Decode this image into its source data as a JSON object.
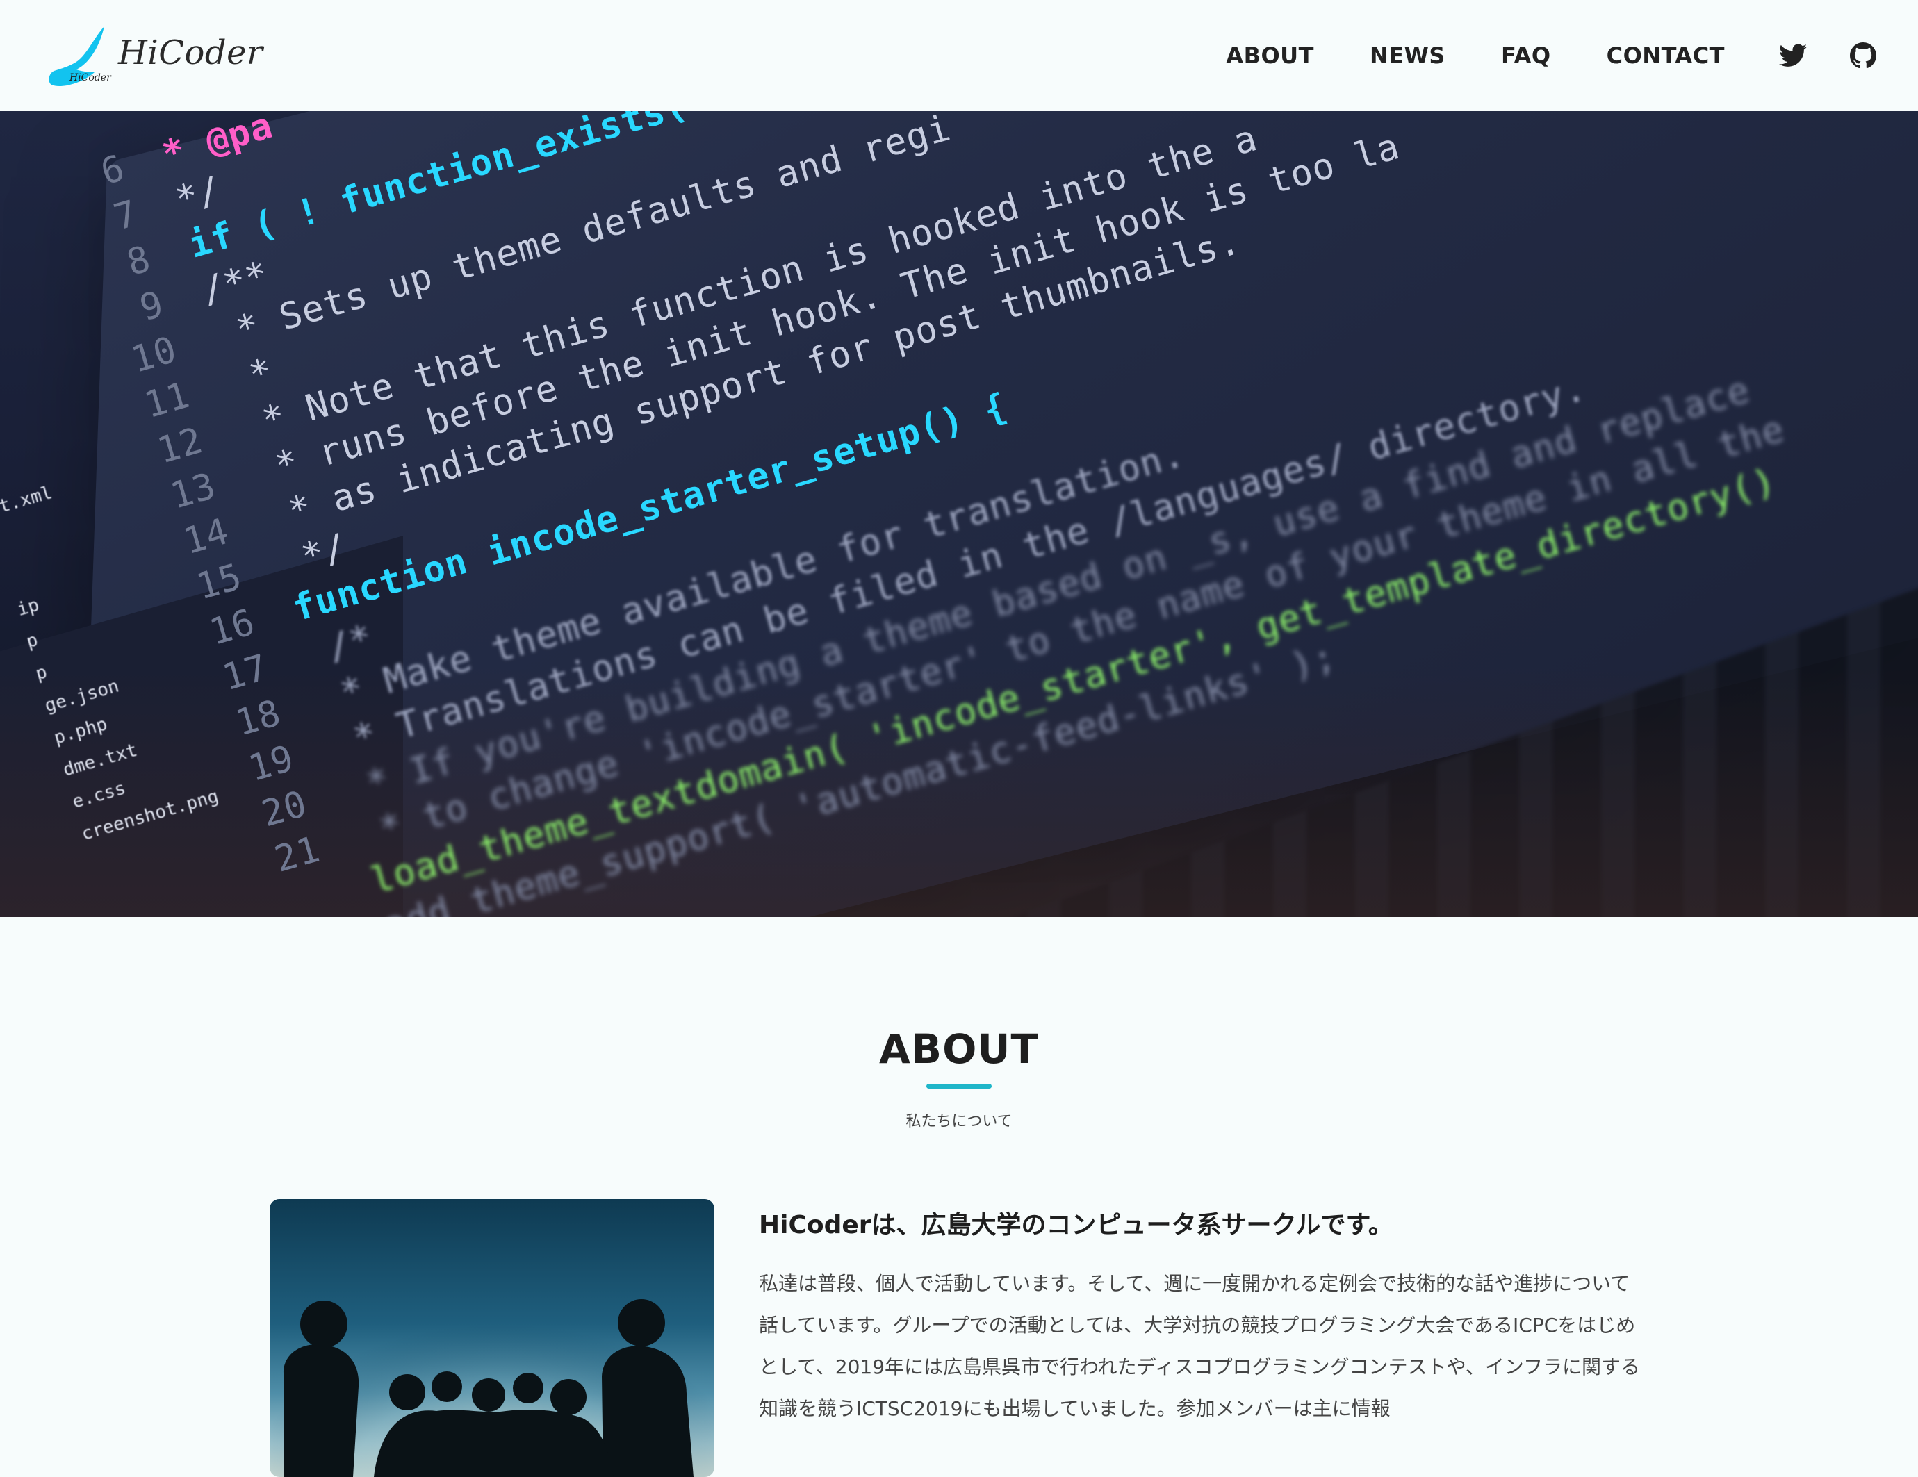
{
  "brand": {
    "name": "HiCoder",
    "mark_text": "HiCoder",
    "accent_color": "#1fb6c9"
  },
  "nav": {
    "items": [
      "ABOUT",
      "NEWS",
      "FAQ",
      "CONTACT"
    ],
    "icons": [
      "twitter-icon",
      "github-icon"
    ]
  },
  "hero": {
    "code_lines": [
      {
        "num": "6",
        "text": "* @pa"
      },
      {
        "num": "7",
        "text": "*/"
      },
      {
        "num": "8",
        "text": "if ( ! function_exists("
      },
      {
        "num": "9",
        "text": "/**"
      },
      {
        "num": "10",
        "text": " * Sets up theme defaults and regi"
      },
      {
        "num": "11",
        "text": " *"
      },
      {
        "num": "12",
        "text": " * Note that this function is hooked into the a"
      },
      {
        "num": "13",
        "text": " * runs before the init hook. The init hook is too la"
      },
      {
        "num": "14",
        "text": " * as indicating support for post thumbnails."
      },
      {
        "num": "15",
        "text": " */"
      },
      {
        "num": "16",
        "text": "function incode_starter_setup() {"
      },
      {
        "num": "17",
        "text": "  /*"
      },
      {
        "num": "18",
        "text": "   * Make theme available for translation."
      },
      {
        "num": "19",
        "text": "   * Translations can be filed in the /languages/ directory."
      },
      {
        "num": "20",
        "text": "   * If you're building a theme based on _s, use a find and replace"
      },
      {
        "num": "21",
        "text": "   * to change 'incode_starter' to the name of your theme in all the"
      }
    ],
    "code_tail_1": "load_theme_textdomain( 'incode_starter', get_template_directory()",
    "code_tail_2": "add_theme_support( 'automatic-feed-links' );",
    "side_files": [
      "st.xml",
      "ip",
      "p",
      "p",
      "ge.json",
      "p.php",
      "dme.txt",
      "e.css",
      "creenshot.png"
    ]
  },
  "about": {
    "title": "ABOUT",
    "subtitle": "私たちについて",
    "heading": "HiCoderは、広島大学のコンピュータ系サークルです。",
    "body": "私達は普段、個人で活動しています。そして、週に一度開かれる定例会で技術的な話や進捗について話しています。グループでの活動としては、大学対抗の競技プログラミング大会であるICPCをはじめとして、2019年には広島県呉市で行われたディスコプログラミングコンテストや、インフラに関する知識を競うICTSC2019にも出場していました。参加メンバーは主に情報"
  }
}
